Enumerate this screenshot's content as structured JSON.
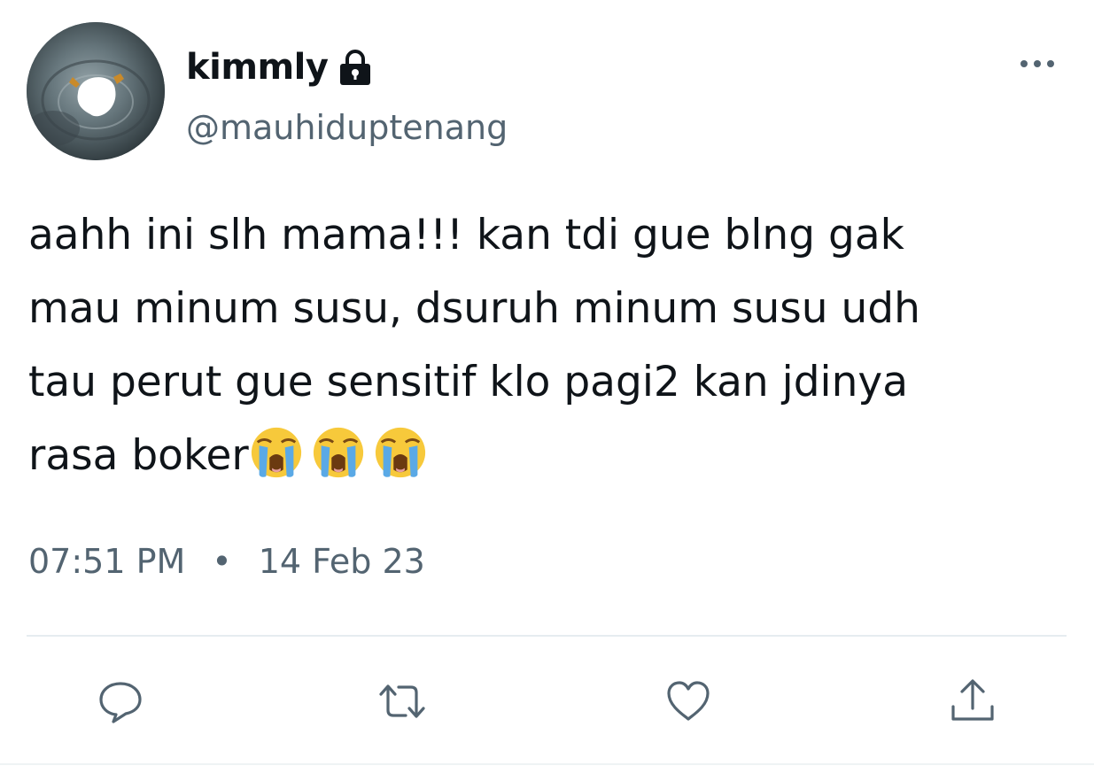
{
  "user": {
    "display_name": "kimmly",
    "handle": "@mauhiduptenang",
    "protected": true
  },
  "tweet": {
    "text": "aahh ini slh mama!!! kan tdi gue blng gak\nmau minum susu, dsuruh minum susu udh\ntau perut gue sensitif klo pagi2 kan jdinya\nrasa boker",
    "emojis": [
      "loudly-crying-face",
      "loudly-crying-face",
      "loudly-crying-face"
    ],
    "time": "07:51 PM",
    "separator": "•",
    "date": "14 Feb 23"
  },
  "actions": {
    "icons": [
      "reply-icon",
      "retweet-icon",
      "like-icon",
      "share-icon"
    ]
  },
  "colors": {
    "text_primary": "#0f1419",
    "text_secondary": "#536471",
    "divider": "#e6ecf0"
  }
}
